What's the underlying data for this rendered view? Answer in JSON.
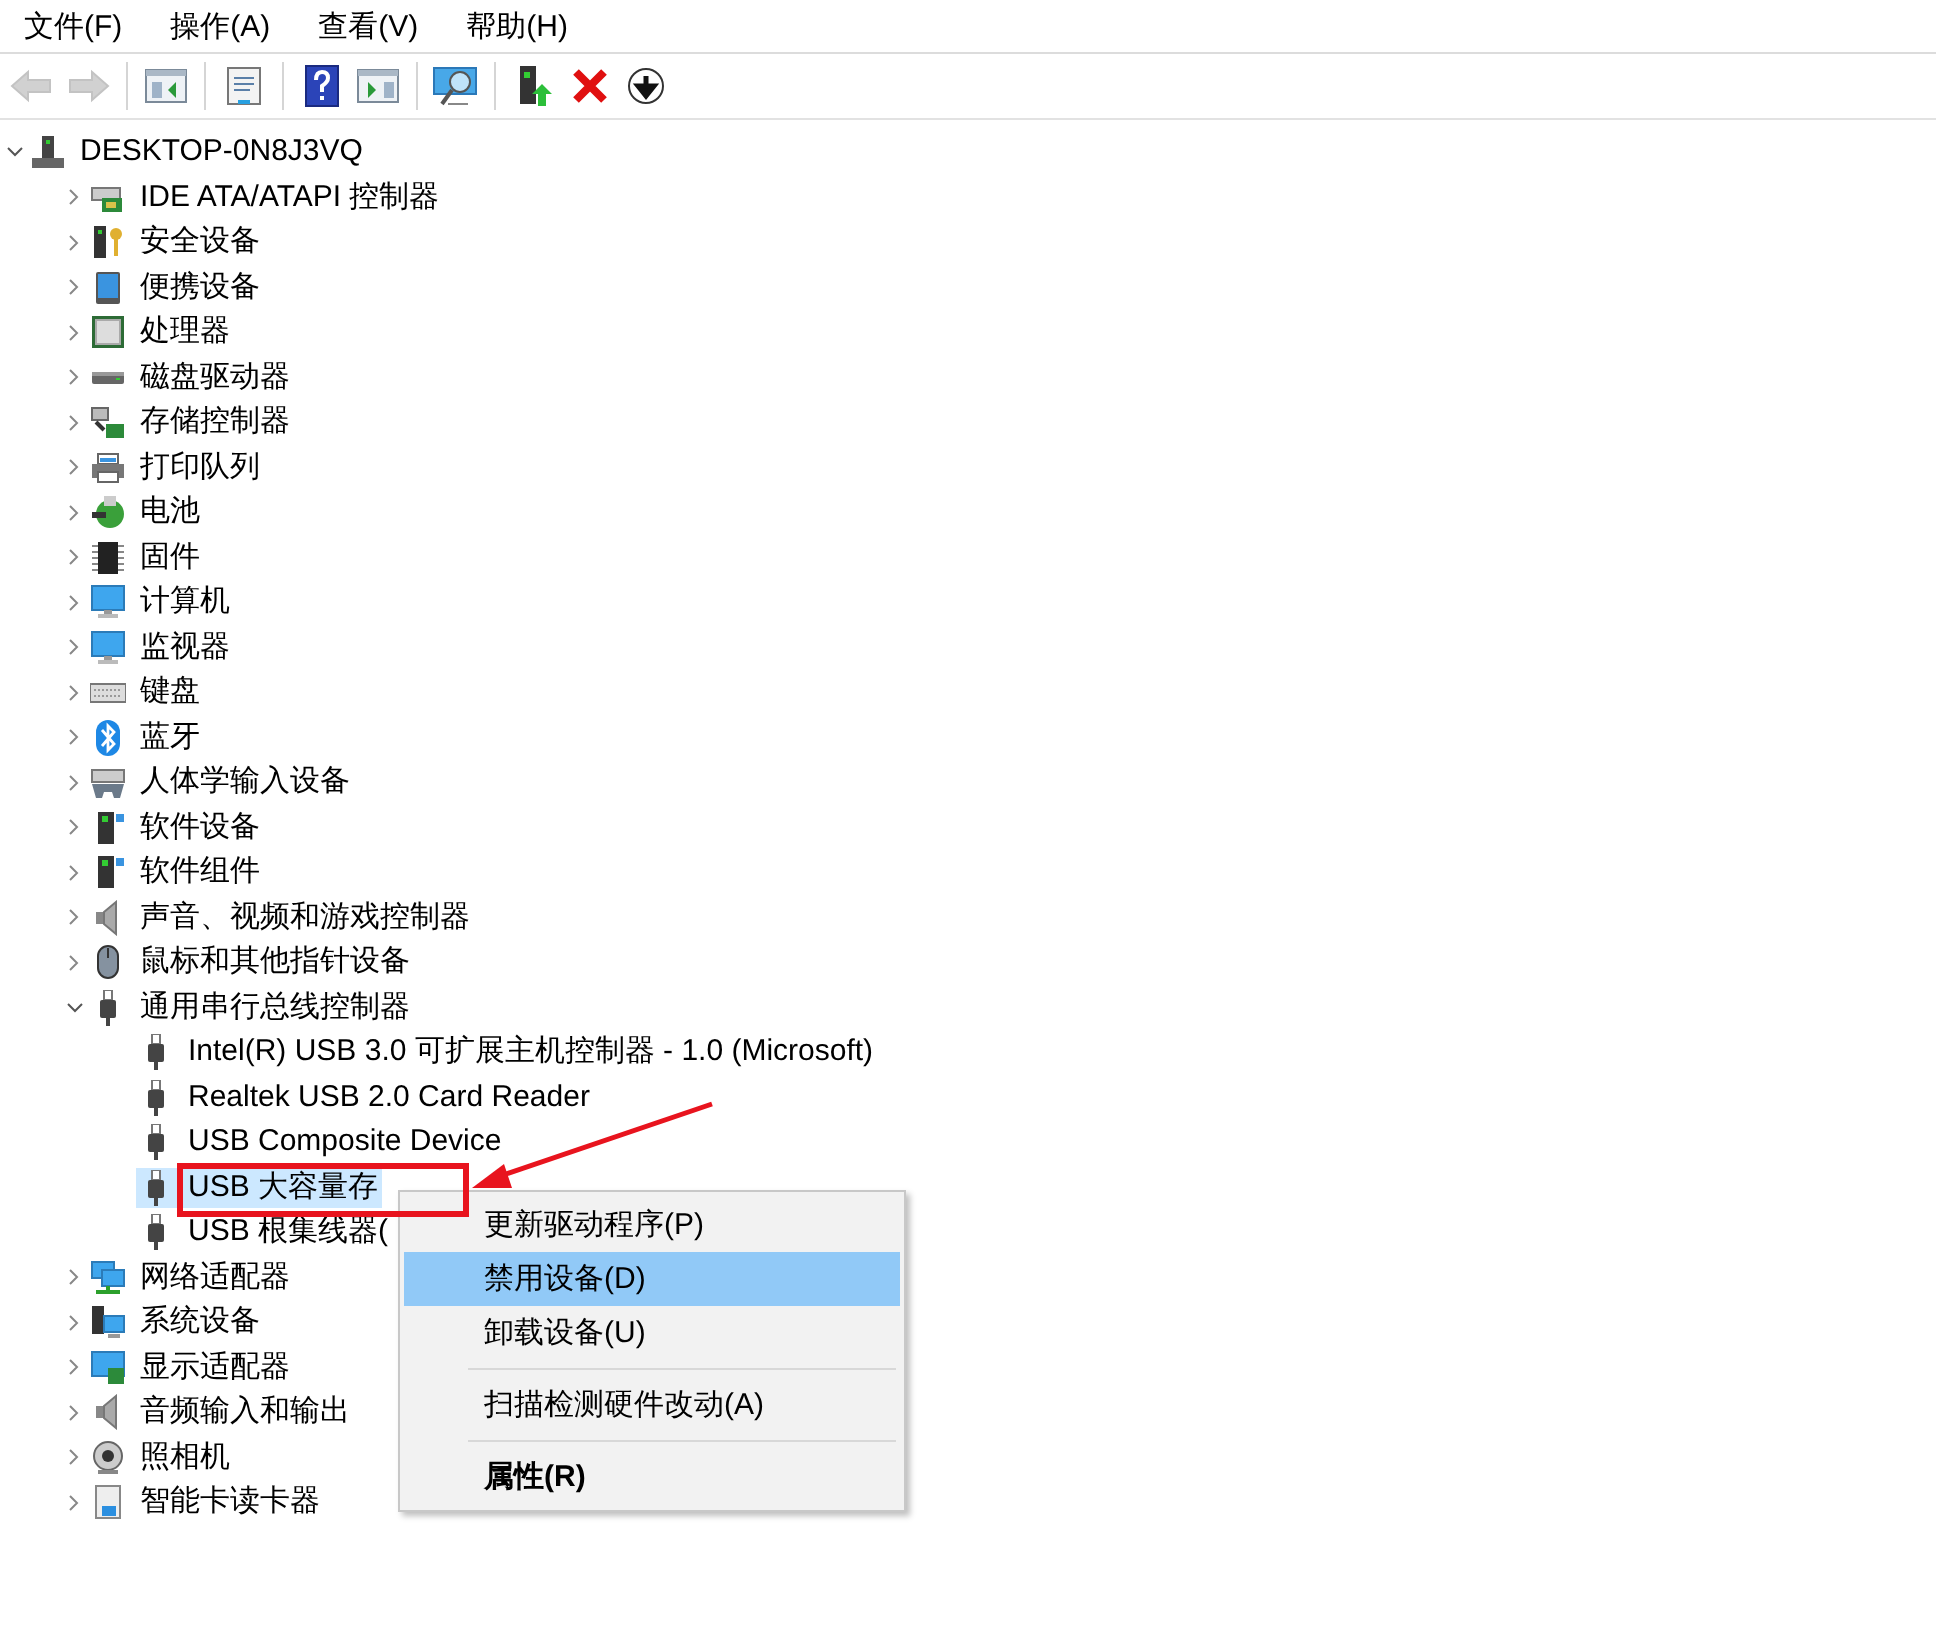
{
  "menu_bar": [
    {
      "label": "文件(F)"
    },
    {
      "label": "操作(A)"
    },
    {
      "label": "查看(V)"
    },
    {
      "label": "帮助(H)"
    }
  ],
  "toolbar": [
    {
      "kind": "back",
      "disabled": true
    },
    {
      "kind": "forward",
      "disabled": true
    },
    {
      "kind": "sep"
    },
    {
      "kind": "panel",
      "disabled": false
    },
    {
      "kind": "sep"
    },
    {
      "kind": "properties",
      "disabled": false
    },
    {
      "kind": "sep"
    },
    {
      "kind": "help",
      "disabled": false
    },
    {
      "kind": "panel2",
      "disabled": false
    },
    {
      "kind": "sep"
    },
    {
      "kind": "scan",
      "disabled": false
    },
    {
      "kind": "sep"
    },
    {
      "kind": "update",
      "disabled": false
    },
    {
      "kind": "remove",
      "disabled": false
    },
    {
      "kind": "download",
      "disabled": false
    }
  ],
  "tree": {
    "label": "DESKTOP-0N8J3VQ",
    "kind": "computer-root",
    "expanded": true,
    "children": [
      {
        "label": "IDE ATA/ATAPI 控制器",
        "kind": "card",
        "expanded": false
      },
      {
        "label": "安全设备",
        "kind": "security",
        "expanded": false
      },
      {
        "label": "便携设备",
        "kind": "portable",
        "expanded": false
      },
      {
        "label": "处理器",
        "kind": "cpu",
        "expanded": false
      },
      {
        "label": "磁盘驱动器",
        "kind": "disk",
        "expanded": false
      },
      {
        "label": "存储控制器",
        "kind": "storage",
        "expanded": false
      },
      {
        "label": "打印队列",
        "kind": "printer",
        "expanded": false
      },
      {
        "label": "电池",
        "kind": "battery",
        "expanded": false
      },
      {
        "label": "固件",
        "kind": "chip",
        "expanded": false
      },
      {
        "label": "计算机",
        "kind": "monitor",
        "expanded": false
      },
      {
        "label": "监视器",
        "kind": "monitor",
        "expanded": false
      },
      {
        "label": "键盘",
        "kind": "keyboard",
        "expanded": false
      },
      {
        "label": "蓝牙",
        "kind": "bluetooth",
        "expanded": false
      },
      {
        "label": "人体学输入设备",
        "kind": "hid",
        "expanded": false
      },
      {
        "label": "软件设备",
        "kind": "software",
        "expanded": false
      },
      {
        "label": "软件组件",
        "kind": "software",
        "expanded": false
      },
      {
        "label": "声音、视频和游戏控制器",
        "kind": "speaker",
        "expanded": false
      },
      {
        "label": "鼠标和其他指针设备",
        "kind": "mouse",
        "expanded": false
      },
      {
        "label": "通用串行总线控制器",
        "kind": "usb",
        "expanded": true,
        "children": [
          {
            "label": "Intel(R) USB 3.0 可扩展主机控制器 - 1.0 (Microsoft)",
            "kind": "usb",
            "selected": false
          },
          {
            "label": "Realtek USB 2.0 Card Reader",
            "kind": "usb",
            "selected": false
          },
          {
            "label": "USB Composite Device",
            "kind": "usb",
            "selected": false
          },
          {
            "label": "USB 大容量存",
            "kind": "usb",
            "selected": true
          },
          {
            "label": "USB 根集线器(",
            "kind": "usb",
            "selected": false
          }
        ]
      },
      {
        "label": "网络适配器",
        "kind": "network",
        "expanded": false
      },
      {
        "label": "系统设备",
        "kind": "system",
        "expanded": false
      },
      {
        "label": "显示适配器",
        "kind": "display",
        "expanded": false
      },
      {
        "label": "音频输入和输出",
        "kind": "speaker",
        "expanded": false
      },
      {
        "label": "照相机",
        "kind": "camera",
        "expanded": false
      },
      {
        "label": "智能卡读卡器",
        "kind": "smartcard",
        "expanded": false
      }
    ]
  },
  "context_menu": [
    {
      "kind": "item",
      "label": "更新驱动程序(P)",
      "selected": false,
      "default": false
    },
    {
      "kind": "item",
      "label": "禁用设备(D)",
      "selected": true,
      "default": false
    },
    {
      "kind": "item",
      "label": "卸载设备(U)",
      "selected": false,
      "default": false
    },
    {
      "kind": "separator"
    },
    {
      "kind": "item",
      "label": "扫描检测硬件改动(A)",
      "selected": false,
      "default": false
    },
    {
      "kind": "separator"
    },
    {
      "kind": "item",
      "label": "属性(R)",
      "selected": false,
      "default": true
    }
  ]
}
